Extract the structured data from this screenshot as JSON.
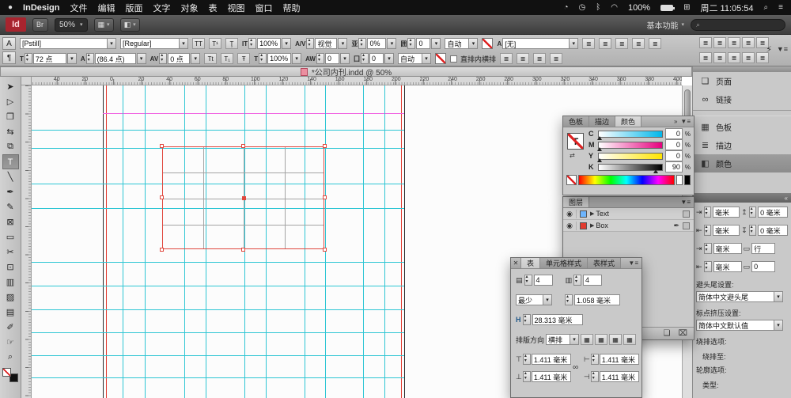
{
  "menubar": {
    "app_name": "InDesign",
    "items": [
      "文件",
      "编辑",
      "版面",
      "文字",
      "对象",
      "表",
      "视图",
      "窗口",
      "帮助"
    ],
    "battery": "100%",
    "clock": "周二 11:05:54"
  },
  "appbar": {
    "logo": "Id",
    "zoom": "50%",
    "workspace": "基本功能",
    "search_placeholder": ""
  },
  "glyphs": {
    "apple": "●",
    "user": "◔",
    "clockicon": "◷",
    "bluetooth": "ᛒ",
    "wifi": "◠",
    "menugrid": "⊞",
    "spotlight": "⌕",
    "notif": "≡",
    "bridge": "Br",
    "viewopts": "▦",
    "screenmode": "◧",
    "charmode": "A",
    "paramode": "¶",
    "tt": "TT",
    "t1": "T¹",
    "tund": "Ţ",
    "tt2": "Tt",
    "tsub": "T₁",
    "tstr": "Ŧ",
    "vscale": "IT",
    "hscale": "T",
    "kern": "A/V",
    "track": "AV",
    "aw": "AW",
    "propspc": "亚",
    "gridnum": "囲",
    "gridnum2": "囗",
    "fontsize": "T",
    "leading": "A",
    "styleA": "A",
    "align": "≣",
    "lightning": "⚡",
    "panelmenu": "▼≡",
    "expand": "»",
    "collapse": "«",
    "close": "✕",
    "pages": "❏",
    "links": "∞",
    "swatches": "▦",
    "strokeicon": "≣",
    "coloricon": "◧",
    "eye": "◉",
    "pen": "✒",
    "newlayer": "❏",
    "trash": "⌧",
    "rows": "▤",
    "cols": "▥",
    "colwidth": "H",
    "linkchain": "∞",
    "insets": [
      "⊤",
      "⊥",
      "⊢",
      "⊣"
    ],
    "cellalign": "▦",
    "indentl": "⇥",
    "indentr": "⇤",
    "spaceb": "↥",
    "spacea": "↧",
    "gridbox": "▭"
  },
  "tools": [
    {
      "name": "selection",
      "glyph": "➤"
    },
    {
      "name": "direct-selection",
      "glyph": "▷"
    },
    {
      "name": "page",
      "glyph": "❐"
    },
    {
      "name": "gap",
      "glyph": "⇆"
    },
    {
      "name": "content-collector",
      "glyph": "⧉"
    },
    {
      "name": "type",
      "glyph": "T"
    },
    {
      "name": "line",
      "glyph": "╲"
    },
    {
      "name": "pen",
      "glyph": "✒"
    },
    {
      "name": "pencil",
      "glyph": "✎"
    },
    {
      "name": "rectangle-frame",
      "glyph": "⊠"
    },
    {
      "name": "rectangle",
      "glyph": "▭"
    },
    {
      "name": "scissors",
      "glyph": "✂"
    },
    {
      "name": "free-transform",
      "glyph": "⊡"
    },
    {
      "name": "gradient",
      "glyph": "▥"
    },
    {
      "name": "gradient-feather",
      "glyph": "▨"
    },
    {
      "name": "note",
      "glyph": "▤"
    },
    {
      "name": "eyedropper",
      "glyph": "✐"
    },
    {
      "name": "hand",
      "glyph": "☞"
    },
    {
      "name": "zoom",
      "glyph": "⌕"
    }
  ],
  "control": {
    "row1": {
      "font_family": "[Pstill]",
      "font_style": "[Regular]",
      "vscale": "100%",
      "kerning": "视觉",
      "prop_spacing": "0%",
      "grid_num": "0",
      "auto": "自动",
      "char_style": "[无]"
    },
    "row2": {
      "font_size": "72 点",
      "leading": "(86.4 点)",
      "tracking": "0 点",
      "hscale": "100%",
      "aki": "0",
      "grid_num": "0",
      "auto": "自动",
      "checkbox_label": "直排内横排"
    }
  },
  "document": {
    "title": "*公司内刊.indd @ 50%"
  },
  "hruler": {
    "labels": [
      "60",
      "40",
      "20",
      "0",
      "20",
      "40",
      "60",
      "80",
      "100",
      "120",
      "140",
      "160",
      "180",
      "200",
      "220",
      "240",
      "260",
      "280",
      "300",
      "320",
      "340",
      "360",
      "380",
      "400"
    ]
  },
  "color_panel": {
    "tabs": [
      "色板",
      "描边",
      "颜色"
    ],
    "channels": [
      {
        "label": "C",
        "value": "0",
        "unit": "%"
      },
      {
        "label": "M",
        "value": "0",
        "unit": "%"
      },
      {
        "label": "Y",
        "value": "0",
        "unit": "%"
      },
      {
        "label": "K",
        "value": "90",
        "unit": "%"
      }
    ]
  },
  "layers_panel": {
    "tab": "图层",
    "rows": [
      {
        "label": "Text",
        "chip": "#6fb7ff"
      },
      {
        "label": "Box",
        "chip": "#e23b2e"
      }
    ]
  },
  "table_panel": {
    "tabs": [
      "表",
      "单元格样式",
      "表样式"
    ],
    "body_rows": "4",
    "body_cols": "4",
    "row_height_mode": "最少",
    "row_height": "1.058 毫米",
    "col_width": "28.313 毫米",
    "direction_label": "排版方向",
    "direction": "横排",
    "insets": [
      "1.411 毫米",
      "1.411 毫米",
      "1.411 毫米",
      "1.411 毫米"
    ]
  },
  "dock": {
    "items": [
      "页面",
      "链接",
      "色板",
      "描边",
      "颜色"
    ]
  },
  "props": {
    "fields": [
      "毫米",
      "0 毫米",
      "毫米",
      "0 毫米",
      "毫米",
      "行",
      "毫米",
      "0"
    ],
    "kinsoku_label": "避头尾设置:",
    "kinsoku_value": "简体中文避头尾",
    "mojikumi_label": "标点挤压设置:",
    "mojikumi_value": "简体中文默认值",
    "wrap_options_label": "绕排选项:",
    "wrap_to_label": "绕排至:",
    "contour_label": "轮廓选项:",
    "type_label": "类型:"
  },
  "colors": {
    "guide": "#2ec6d4",
    "margin": "#f062e2",
    "frame": "#e0483e",
    "bleed": "#e23b30",
    "page_edge": "#2b2b2b",
    "id_logo": "#a8242e"
  }
}
